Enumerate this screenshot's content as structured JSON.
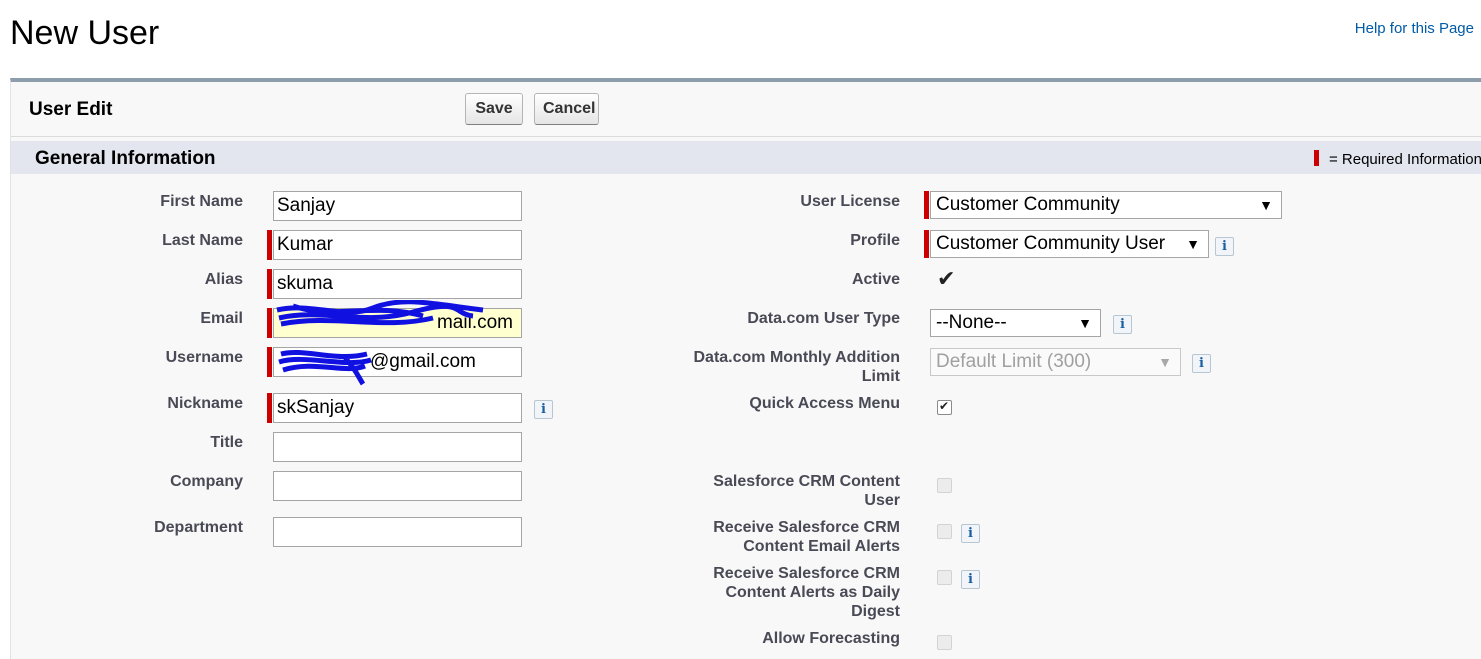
{
  "page": {
    "title": "New User",
    "help_link": "Help for this Page"
  },
  "panel": {
    "title": "User Edit",
    "save_label": "Save",
    "cancel_label": "Cancel"
  },
  "section": {
    "title": "General Information",
    "required_legend": "= Required Information"
  },
  "left_fields": {
    "first_name": {
      "label": "First Name",
      "value": "Sanjay"
    },
    "last_name": {
      "label": "Last Name",
      "value": "Kumar"
    },
    "alias": {
      "label": "Alias",
      "value": "skuma"
    },
    "email": {
      "label": "Email",
      "value": "@gmail.com",
      "visible_fragment": "mail.com"
    },
    "username": {
      "label": "Username",
      "value": "@gmail.com"
    },
    "nickname": {
      "label": "Nickname",
      "value": "skSanjay"
    },
    "title": {
      "label": "Title",
      "value": ""
    },
    "company": {
      "label": "Company",
      "value": ""
    },
    "department": {
      "label": "Department",
      "value": ""
    }
  },
  "right_fields": {
    "user_license": {
      "label": "User License",
      "value": "Customer Community"
    },
    "profile": {
      "label": "Profile",
      "value": "Customer Community User"
    },
    "active": {
      "label": "Active",
      "checked": true
    },
    "datacom_user_type": {
      "label": "Data.com User Type",
      "value": "--None--"
    },
    "datacom_monthly_limit": {
      "label_line1": "Data.com Monthly Addition",
      "label_line2": "Limit",
      "value": "Default Limit (300)"
    },
    "quick_access_menu": {
      "label": "Quick Access Menu",
      "checked": true
    },
    "crm_content_user": {
      "label_line1": "Salesforce CRM Content",
      "label_line2": "User",
      "checked": false
    },
    "crm_email_alerts": {
      "label_line1": "Receive Salesforce CRM",
      "label_line2": "Content Email Alerts",
      "checked": false
    },
    "crm_daily_digest": {
      "label_line1": "Receive Salesforce CRM",
      "label_line2": "Content Alerts as Daily",
      "label_line3": "Digest",
      "checked": false
    },
    "allow_forecasting": {
      "label": "Allow Forecasting",
      "checked": false
    }
  },
  "icons": {
    "info": "i",
    "dropdown_arrow": "▼",
    "checkmark": "✔"
  },
  "colors": {
    "required": "#cc0000",
    "link": "#015ba7",
    "section_bg": "#e3e6ef",
    "panel_border": "#8e9dab",
    "redaction": "#1010e0"
  }
}
